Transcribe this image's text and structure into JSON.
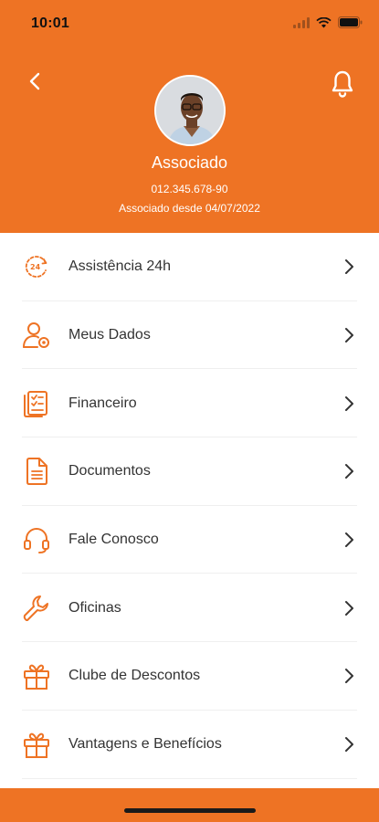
{
  "status_bar": {
    "time": "10:01"
  },
  "header": {
    "name": "Associado",
    "code": "012.345.678-90",
    "member_since": "Associado desde 04/07/2022"
  },
  "menu": [
    {
      "label": "Assistência 24h",
      "icon": "24h-clock-icon"
    },
    {
      "label": "Meus Dados",
      "icon": "user-settings-icon"
    },
    {
      "label": "Financeiro",
      "icon": "invoice-checklist-icon"
    },
    {
      "label": "Documentos",
      "icon": "document-icon"
    },
    {
      "label": "Fale Conosco",
      "icon": "headset-icon"
    },
    {
      "label": "Oficinas",
      "icon": "wrench-icon"
    },
    {
      "label": "Clube de Descontos",
      "icon": "gift-icon"
    },
    {
      "label": "Vantagens e Benefícios",
      "icon": "gift-icon"
    }
  ],
  "colors": {
    "brand": "#EE7324",
    "text": "#333333",
    "divider": "#EFEFEF"
  }
}
